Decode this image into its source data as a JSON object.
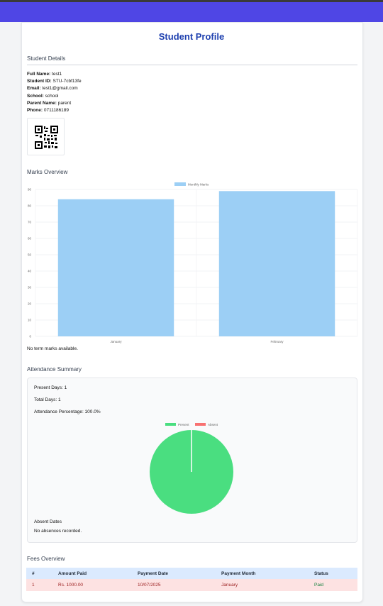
{
  "page": {
    "title": "Student Profile"
  },
  "details": {
    "heading": "Student Details",
    "full_name_label": "Full Name:",
    "full_name": "test1",
    "student_id_label": "Student ID:",
    "student_id": "STU-7cbf13fe",
    "email_label": "Email:",
    "email": "test1@gmail.com",
    "school_label": "School:",
    "school": "school",
    "parent_label": "Parent Name:",
    "parent": "parent",
    "phone_label": "Phone:",
    "phone": "0711186189"
  },
  "qr": {
    "icon": "qr-code-icon"
  },
  "marks": {
    "heading": "Marks Overview",
    "note": "No term marks available."
  },
  "attendance": {
    "heading": "Attendance Summary",
    "present_text": "Present Days: 1",
    "total_text": "Total Days: 1",
    "percentage_text": "Attendance Percentage: 100.0%",
    "absent_heading": "Absent Dates",
    "absent_note": "No absences recorded."
  },
  "fees": {
    "heading": "Fees Overview",
    "columns": [
      "#",
      "Amount Paid",
      "Payment Date",
      "Payment Month",
      "Status"
    ],
    "rows": [
      {
        "no": "1",
        "amount": "Rs. 1000.00",
        "date": "10/07/2025",
        "month": "January",
        "status": "Paid"
      }
    ]
  },
  "colors": {
    "brand": "#4f46e5",
    "title": "#1e40af",
    "bar": "#9ccff5",
    "present": "#4ade80",
    "absent": "#f87171"
  },
  "chart_data": [
    {
      "type": "bar",
      "title": "",
      "categories": [
        "January",
        "February"
      ],
      "series": [
        {
          "name": "Monthly Marks",
          "values": [
            84,
            89
          ]
        }
      ],
      "ylim": [
        0,
        90
      ],
      "yticks": [
        0,
        10,
        20,
        30,
        40,
        50,
        60,
        70,
        80,
        90
      ],
      "xlabel": "",
      "ylabel": "",
      "grid": true,
      "legend": "top"
    },
    {
      "type": "pie",
      "title": "",
      "categories": [
        "Present",
        "Absent"
      ],
      "values": [
        1,
        0
      ],
      "legend": "top"
    }
  ]
}
